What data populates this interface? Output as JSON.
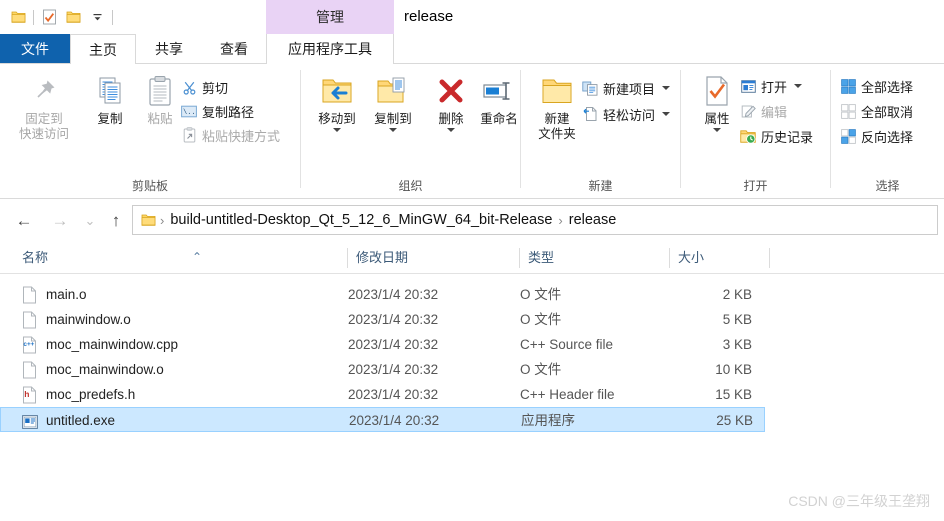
{
  "window": {
    "title": "release",
    "contextual_tab_group": "管理"
  },
  "quick_access_toolbar": {
    "items": [
      {
        "name": "folder-icon",
        "label": "文件夹"
      },
      {
        "name": "properties-icon",
        "label": "属性"
      },
      {
        "name": "new-folder-icon",
        "label": "新建文件夹"
      },
      {
        "name": "customize-icon",
        "label": "自定义快速访问工具栏"
      }
    ]
  },
  "tabs": [
    {
      "id": "file",
      "label": "文件"
    },
    {
      "id": "home",
      "label": "主页"
    },
    {
      "id": "share",
      "label": "共享"
    },
    {
      "id": "view",
      "label": "查看"
    },
    {
      "id": "apptools",
      "label": "应用程序工具"
    }
  ],
  "ribbon": {
    "groups": [
      {
        "id": "clipboard",
        "title": "剪贴板",
        "big_buttons": [
          {
            "id": "pin",
            "label_line1": "固定到",
            "label_line2": "快速访问",
            "icon": "pin-icon",
            "disabled": true
          },
          {
            "id": "copy",
            "label_line1": "复制",
            "label_line2": "",
            "icon": "copy-icon",
            "disabled": false
          },
          {
            "id": "paste",
            "label_line1": "粘贴",
            "label_line2": "",
            "icon": "paste-icon",
            "disabled": true
          }
        ],
        "small_buttons": [
          {
            "id": "cut",
            "label": "剪切",
            "icon": "scissors-icon",
            "disabled": false
          },
          {
            "id": "copy-path",
            "label": "复制路径",
            "icon": "copy-path-icon",
            "disabled": false
          },
          {
            "id": "paste-shortcut",
            "label": "粘贴快捷方式",
            "icon": "paste-shortcut-icon",
            "disabled": true
          }
        ]
      },
      {
        "id": "organize",
        "title": "组织",
        "big_buttons": [
          {
            "id": "move-to",
            "label_line1": "移动到",
            "label_line2": "",
            "icon": "move-to-icon",
            "has_caret": true
          },
          {
            "id": "copy-to",
            "label_line1": "复制到",
            "label_line2": "",
            "icon": "copy-to-icon",
            "has_caret": true
          },
          {
            "id": "delete",
            "label_line1": "删除",
            "label_line2": "",
            "icon": "delete-icon",
            "has_caret": true
          },
          {
            "id": "rename",
            "label_line1": "重命名",
            "label_line2": "",
            "icon": "rename-icon",
            "has_caret": false
          }
        ]
      },
      {
        "id": "new",
        "title": "新建",
        "big_buttons": [
          {
            "id": "new-folder",
            "label_line1": "新建",
            "label_line2": "文件夹",
            "icon": "new-folder-icon"
          }
        ],
        "small_buttons": [
          {
            "id": "new-item",
            "label": "新建项目",
            "icon": "new-item-icon",
            "has_caret": true
          },
          {
            "id": "easy-access",
            "label": "轻松访问",
            "icon": "easy-access-icon",
            "has_caret": true
          }
        ]
      },
      {
        "id": "open",
        "title": "打开",
        "big_buttons": [
          {
            "id": "properties",
            "label_line1": "属性",
            "label_line2": "",
            "icon": "properties-icon",
            "has_caret": true
          }
        ],
        "small_buttons": [
          {
            "id": "open",
            "label": "打开",
            "icon": "open-icon",
            "has_caret": true
          },
          {
            "id": "edit",
            "label": "编辑",
            "icon": "edit-icon",
            "disabled": true
          },
          {
            "id": "history",
            "label": "历史记录",
            "icon": "history-icon"
          }
        ]
      },
      {
        "id": "select",
        "title": "选择",
        "small_buttons": [
          {
            "id": "select-all",
            "label": "全部选择",
            "icon": "select-all-icon"
          },
          {
            "id": "select-none",
            "label": "全部取消",
            "icon": "select-none-icon"
          },
          {
            "id": "invert-selection",
            "label": "反向选择",
            "icon": "invert-selection-icon"
          }
        ]
      }
    ]
  },
  "navigation": {
    "back": "←",
    "forward": "→",
    "recent": "⌄",
    "up": "↑",
    "breadcrumb": [
      "build-untitled-Desktop_Qt_5_12_6_MinGW_64_bit-Release",
      "release"
    ],
    "separator": "›"
  },
  "file_list": {
    "columns": [
      {
        "id": "name",
        "label": "名称",
        "sorted": true,
        "sort_glyph": "⌃"
      },
      {
        "id": "date",
        "label": "修改日期"
      },
      {
        "id": "type",
        "label": "类型"
      },
      {
        "id": "size",
        "label": "大小"
      }
    ],
    "rows": [
      {
        "name": "main.o",
        "date": "2023/1/4 20:32",
        "type": "O 文件",
        "size": "2 KB",
        "icon": "generic-file-icon",
        "selected": false
      },
      {
        "name": "mainwindow.o",
        "date": "2023/1/4 20:32",
        "type": "O 文件",
        "size": "5 KB",
        "icon": "generic-file-icon",
        "selected": false
      },
      {
        "name": "moc_mainwindow.cpp",
        "date": "2023/1/4 20:32",
        "type": "C++ Source file",
        "size": "3 KB",
        "icon": "cpp-file-icon",
        "selected": false
      },
      {
        "name": "moc_mainwindow.o",
        "date": "2023/1/4 20:32",
        "type": "O 文件",
        "size": "10 KB",
        "icon": "generic-file-icon",
        "selected": false
      },
      {
        "name": "moc_predefs.h",
        "date": "2023/1/4 20:32",
        "type": "C++ Header file",
        "size": "15 KB",
        "icon": "header-file-icon",
        "selected": false
      },
      {
        "name": "untitled.exe",
        "date": "2023/1/4 20:32",
        "type": "应用程序",
        "size": "25 KB",
        "icon": "exe-file-icon",
        "selected": true
      }
    ]
  },
  "watermark": {
    "text": "CSDN @三年级王垄翔"
  },
  "colors": {
    "file_tab_blue": "#0f62ad",
    "contextual_band": "#e9d3f5",
    "selection_fill": "#cce8ff",
    "selection_border": "#99d1ff",
    "column_header_text": "#3c5a78"
  }
}
